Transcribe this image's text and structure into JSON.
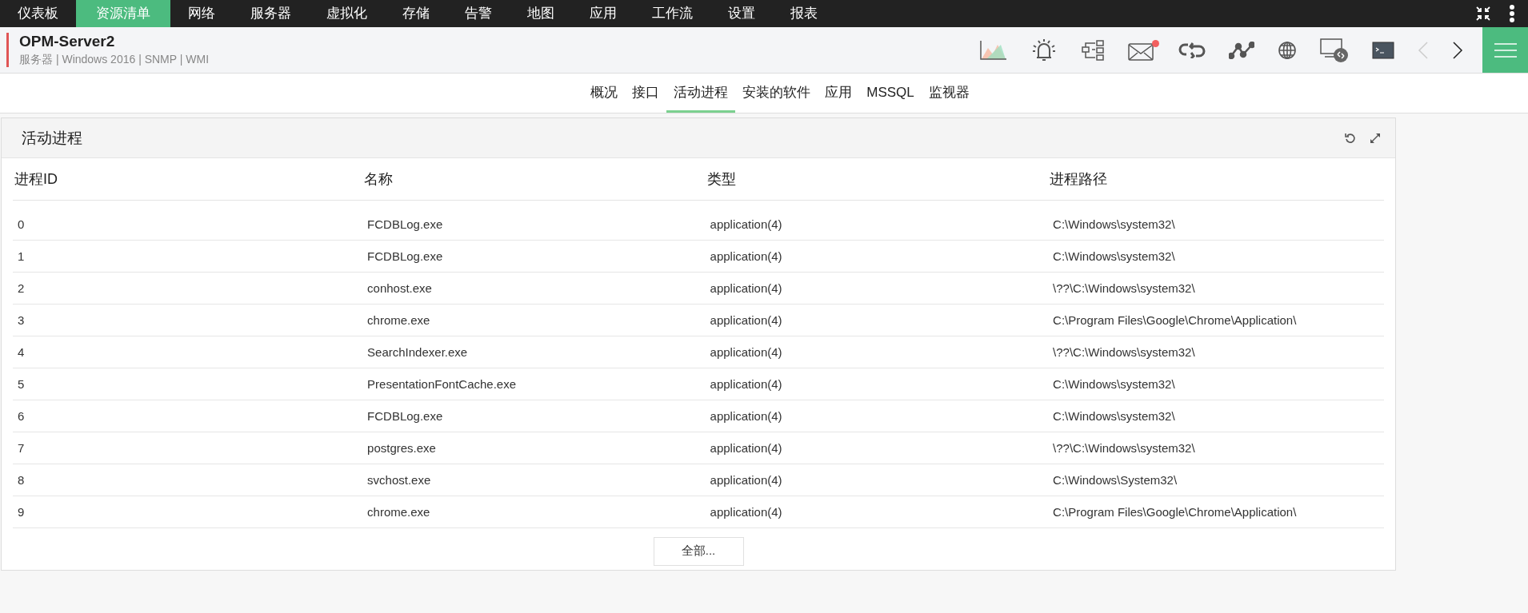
{
  "nav": [
    {
      "label": "仪表板",
      "selected": false
    },
    {
      "label": "资源清单",
      "selected": true
    },
    {
      "label": "网络",
      "selected": false
    },
    {
      "label": "服务器",
      "selected": false
    },
    {
      "label": "虚拟化",
      "selected": false
    },
    {
      "label": "存储",
      "selected": false
    },
    {
      "label": "告警",
      "selected": false
    },
    {
      "label": "地图",
      "selected": false
    },
    {
      "label": "应用",
      "selected": false
    },
    {
      "label": "工作流",
      "selected": false
    },
    {
      "label": "设置",
      "selected": false
    },
    {
      "label": "报表",
      "selected": false
    }
  ],
  "device": {
    "name": "OPM-Server2",
    "details": "服务器 | Windows 2016  | SNMP  | WMI"
  },
  "tabs": [
    {
      "label": "概况",
      "selected": false
    },
    {
      "label": "接口",
      "selected": false
    },
    {
      "label": "活动进程",
      "selected": true
    },
    {
      "label": "安装的软件",
      "selected": false
    },
    {
      "label": "应用",
      "selected": false
    },
    {
      "label": "MSSQL",
      "selected": false
    },
    {
      "label": "监视器",
      "selected": false
    }
  ],
  "panel": {
    "title": "活动进程",
    "table": {
      "columns": [
        "进程ID",
        "名称",
        "类型",
        "进程路径"
      ],
      "rows": [
        [
          "0",
          "FCDBLog.exe",
          "application(4)",
          "C:\\Windows\\system32\\"
        ],
        [
          "1",
          "FCDBLog.exe",
          "application(4)",
          "C:\\Windows\\system32\\"
        ],
        [
          "2",
          "conhost.exe",
          "application(4)",
          "\\??\\C:\\Windows\\system32\\"
        ],
        [
          "3",
          "chrome.exe",
          "application(4)",
          "C:\\Program Files\\Google\\Chrome\\Application\\"
        ],
        [
          "4",
          "SearchIndexer.exe",
          "application(4)",
          "\\??\\C:\\Windows\\system32\\"
        ],
        [
          "5",
          "PresentationFontCache.exe",
          "application(4)",
          "C:\\Windows\\system32\\"
        ],
        [
          "6",
          "FCDBLog.exe",
          "application(4)",
          "C:\\Windows\\system32\\"
        ],
        [
          "7",
          "postgres.exe",
          "application(4)",
          "\\??\\C:\\Windows\\system32\\"
        ],
        [
          "8",
          "svchost.exe",
          "application(4)",
          "C:\\Windows\\System32\\"
        ],
        [
          "9",
          "chrome.exe",
          "application(4)",
          "C:\\Program Files\\Google\\Chrome\\Application\\"
        ]
      ]
    },
    "more_button": "全部..."
  }
}
